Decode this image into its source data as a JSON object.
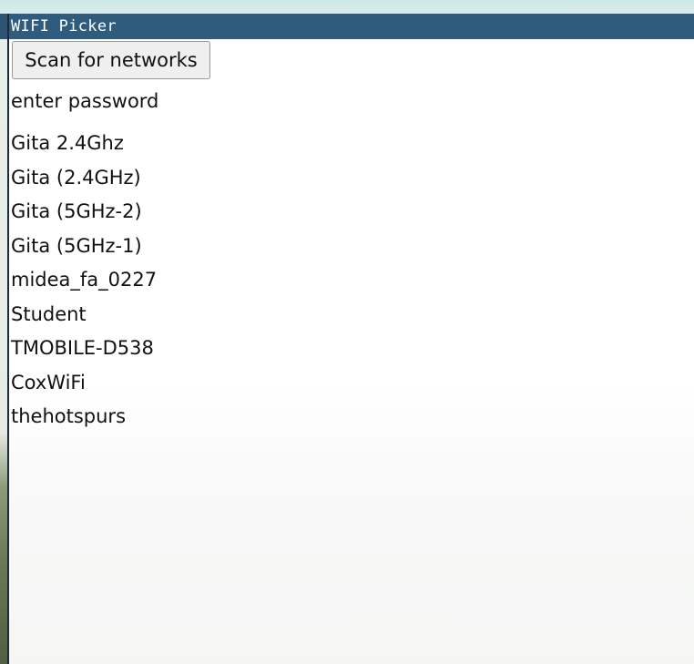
{
  "window": {
    "title": "WIFI Picker"
  },
  "controls": {
    "scan_label": "Scan for networks",
    "password_label": "enter password"
  },
  "networks": [
    "Gita 2.4Ghz",
    "Gita (2.4GHz)",
    "Gita (5GHz-2)",
    "Gita (5GHz-1)",
    "midea_fa_0227",
    "Student",
    "TMOBILE-D538",
    "CoxWiFi",
    "thehotspurs"
  ],
  "colors": {
    "titlebar": "#2f5b7c",
    "window_background": "#ffffff",
    "button_background": "#efefef"
  }
}
